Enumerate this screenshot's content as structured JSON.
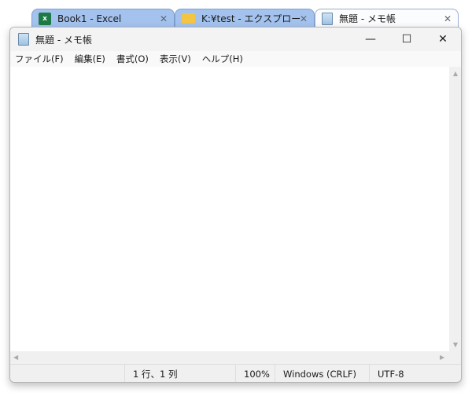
{
  "tabs": [
    {
      "label": "Book1 - Excel",
      "icon": "excel-icon",
      "active": false
    },
    {
      "label": "K:¥test - エクスプローラー",
      "icon": "folder-icon",
      "active": false
    },
    {
      "label": "無題 - メモ帳",
      "icon": "notepad-icon",
      "active": true
    }
  ],
  "window": {
    "title": "無題 - メモ帳",
    "minimize": "—",
    "maximize": "☐",
    "close": "✕"
  },
  "menu": [
    "ファイル(F)",
    "編集(E)",
    "書式(O)",
    "表示(V)",
    "ヘルプ(H)"
  ],
  "editor": {
    "content": ""
  },
  "status": {
    "position": "1 行、1 列",
    "zoom": "100%",
    "line_ending": "Windows (CRLF)",
    "encoding": "UTF-8"
  },
  "tab_close": "✕"
}
